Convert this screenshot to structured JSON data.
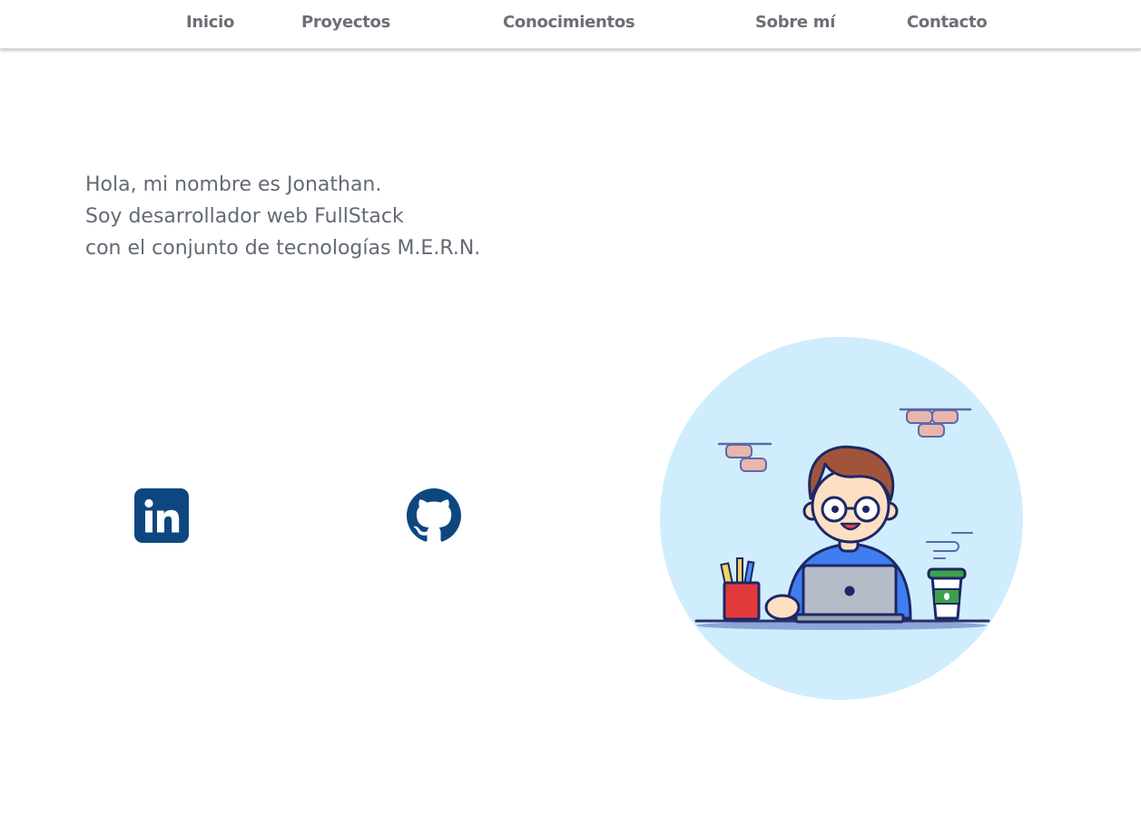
{
  "nav": {
    "items": [
      {
        "label": "Inicio"
      },
      {
        "label": "Proyectos"
      },
      {
        "label": "Conocimientos"
      },
      {
        "label": "Sobre mí"
      },
      {
        "label": "Contacto"
      }
    ]
  },
  "hero": {
    "lines": [
      "Hola, mi nombre es Jonathan.",
      "Soy desarrollador web FullStack",
      "con el conjunto de tecnologías M.E.R.N."
    ]
  },
  "social": {
    "linkedin_icon": "linkedin-icon",
    "github_icon": "github-icon"
  },
  "illustration": {
    "icon": "developer-at-laptop-illustration"
  },
  "colors": {
    "nav_text": "#6b6f76",
    "hero_text": "#636a73",
    "icon_blue": "#0e4780",
    "circle_bg": "#d0edfd"
  }
}
